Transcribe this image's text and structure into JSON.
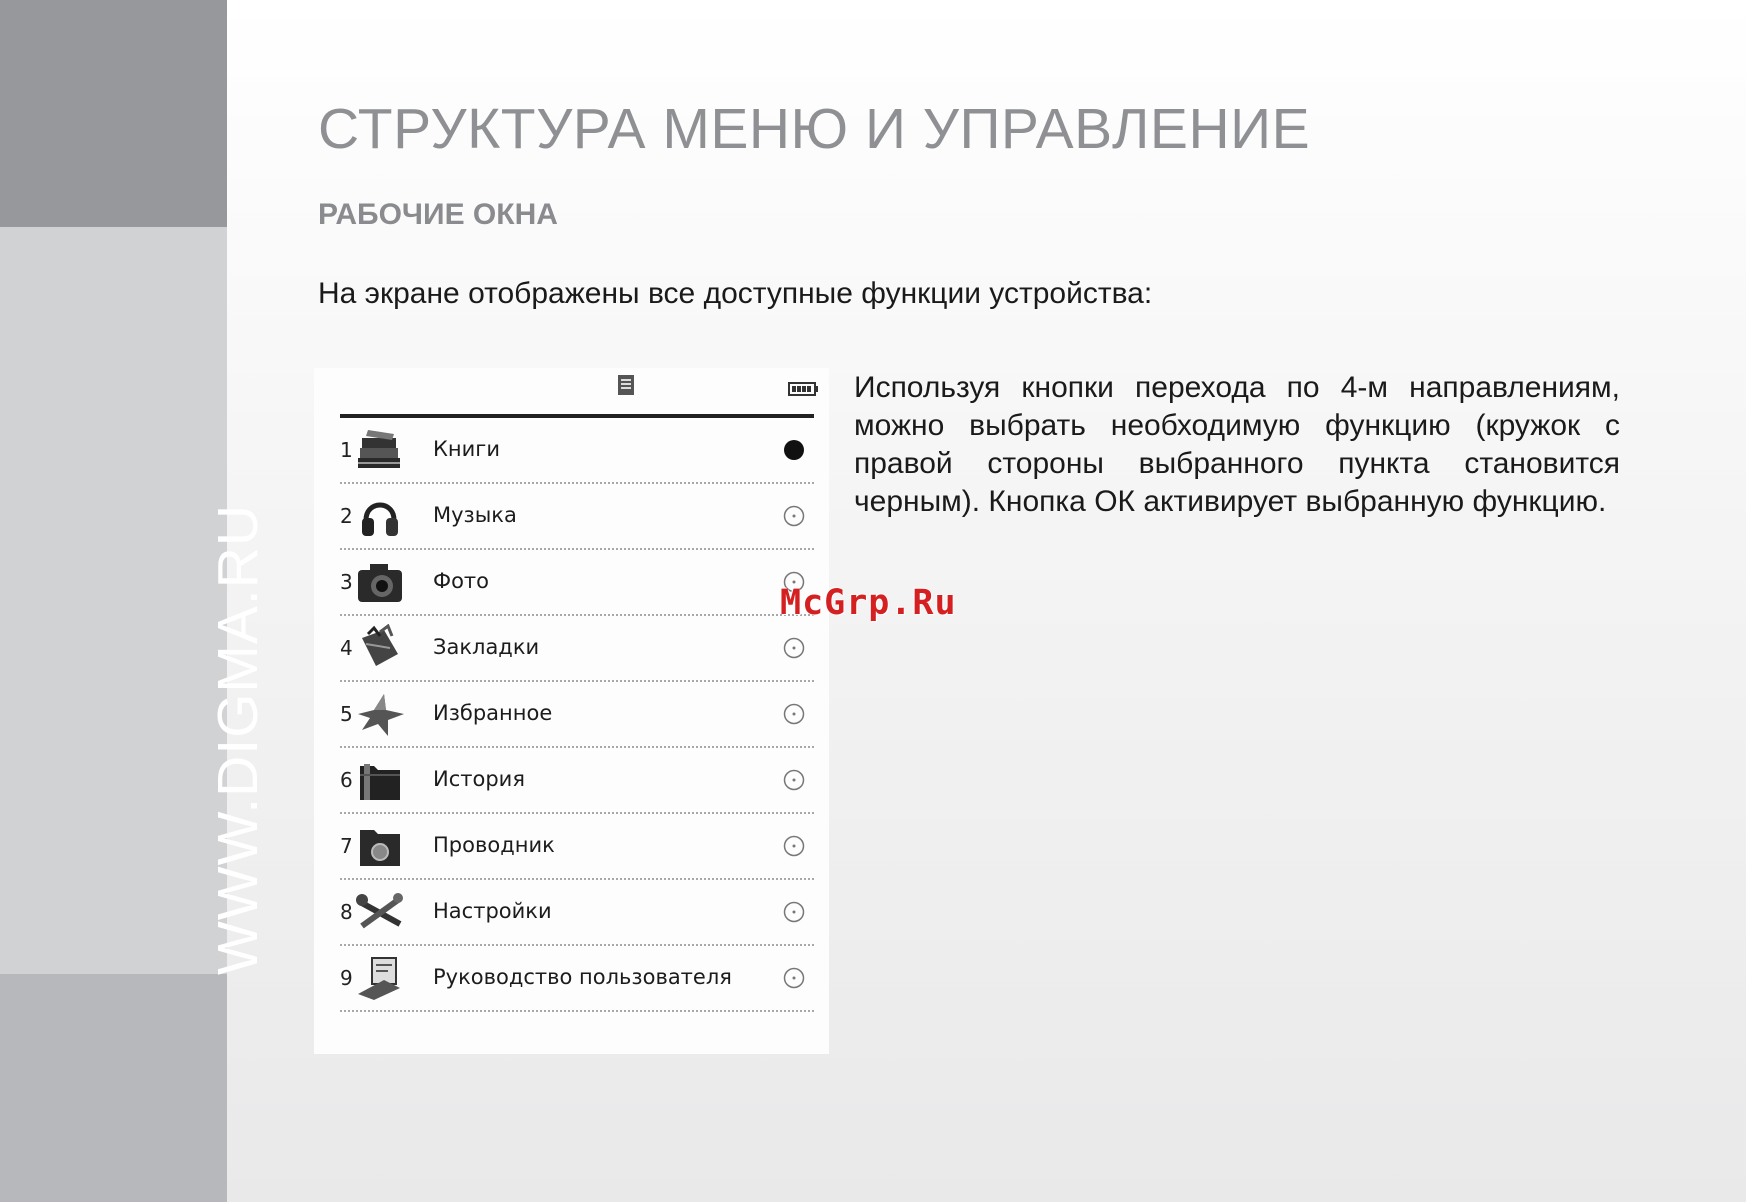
{
  "sidebar": {
    "url_text": "WWW.DIGMA.RU"
  },
  "page": {
    "title": "СТРУКТУРА МЕНЮ И УПРАВЛЕНИЕ",
    "section_heading": "РАБОЧИЕ ОКНА",
    "intro": "На экране отображены все доступные функции устройства:",
    "description": "Используя кнопки перехода по 4-м направлениям, можно выбрать необходимую функцию (кружок с правой стороны выбранного пункта становится черным). Кнопка ОК активирует выбранную функцию."
  },
  "device_screen": {
    "status_icons": [
      "sd-card-icon",
      "battery-icon"
    ],
    "menu_items": [
      {
        "number": "1",
        "label": "Книги",
        "icon": "books-icon",
        "selected": true
      },
      {
        "number": "2",
        "label": "Музыка",
        "icon": "headphones-icon",
        "selected": false
      },
      {
        "number": "3",
        "label": "Фото",
        "icon": "camera-icon",
        "selected": false
      },
      {
        "number": "4",
        "label": "Закладки",
        "icon": "bookmarks-icon",
        "selected": false
      },
      {
        "number": "5",
        "label": "Избранное",
        "icon": "star-icon",
        "selected": false
      },
      {
        "number": "6",
        "label": "История",
        "icon": "history-folder-icon",
        "selected": false
      },
      {
        "number": "7",
        "label": "Проводник",
        "icon": "explorer-folder-icon",
        "selected": false
      },
      {
        "number": "8",
        "label": "Настройки",
        "icon": "settings-tools-icon",
        "selected": false
      },
      {
        "number": "9",
        "label": "Руководство пользователя",
        "icon": "user-guide-icon",
        "selected": false
      }
    ]
  },
  "watermark": {
    "text": "McGrp.Ru"
  },
  "colors": {
    "sidebar_dark": "#97989b",
    "sidebar_light": "#d1d2d4",
    "title_gray": "#8f9093",
    "watermark_red": "#d42020"
  }
}
